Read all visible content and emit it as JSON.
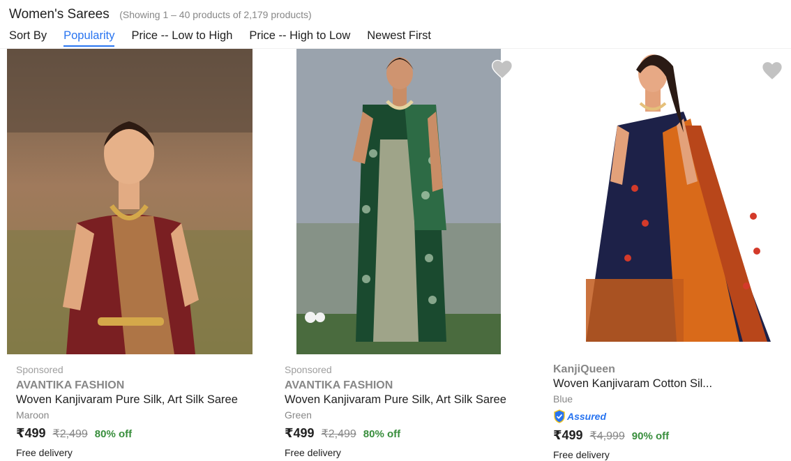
{
  "header": {
    "title": "Women's Sarees",
    "showing": "(Showing 1 – 40 products of 2,179 products)"
  },
  "sort": {
    "label": "Sort By",
    "options": [
      "Popularity",
      "Price -- Low to High",
      "Price -- High to Low",
      "Newest First"
    ],
    "active": "Popularity"
  },
  "products": [
    {
      "sponsored": "Sponsored",
      "brand": "AVANTIKA FASHION",
      "name": "Woven Kanjivaram Pure Silk, Art Silk Saree",
      "color": "Maroon",
      "price": "₹499",
      "mrp": "₹2,499",
      "discount": "80% off",
      "delivery": "Free delivery"
    },
    {
      "sponsored": "Sponsored",
      "brand": "AVANTIKA FASHION",
      "name": "Woven Kanjivaram Pure Silk, Art Silk Saree",
      "color": "Green",
      "price": "₹499",
      "mrp": "₹2,499",
      "discount": "80% off",
      "delivery": "Free delivery"
    },
    {
      "brand": "KanjiQueen",
      "name": "Woven Kanjivaram Cotton Sil...",
      "color": "Blue",
      "assured": "Assured",
      "price": "₹499",
      "mrp": "₹4,999",
      "discount": "90% off",
      "delivery": "Free delivery"
    }
  ],
  "icons": {
    "wishlist": "heart-icon",
    "assured": "shield-check-icon"
  },
  "colors": {
    "accent": "#2874f0",
    "discount": "#388e3c",
    "muted": "#878787"
  }
}
